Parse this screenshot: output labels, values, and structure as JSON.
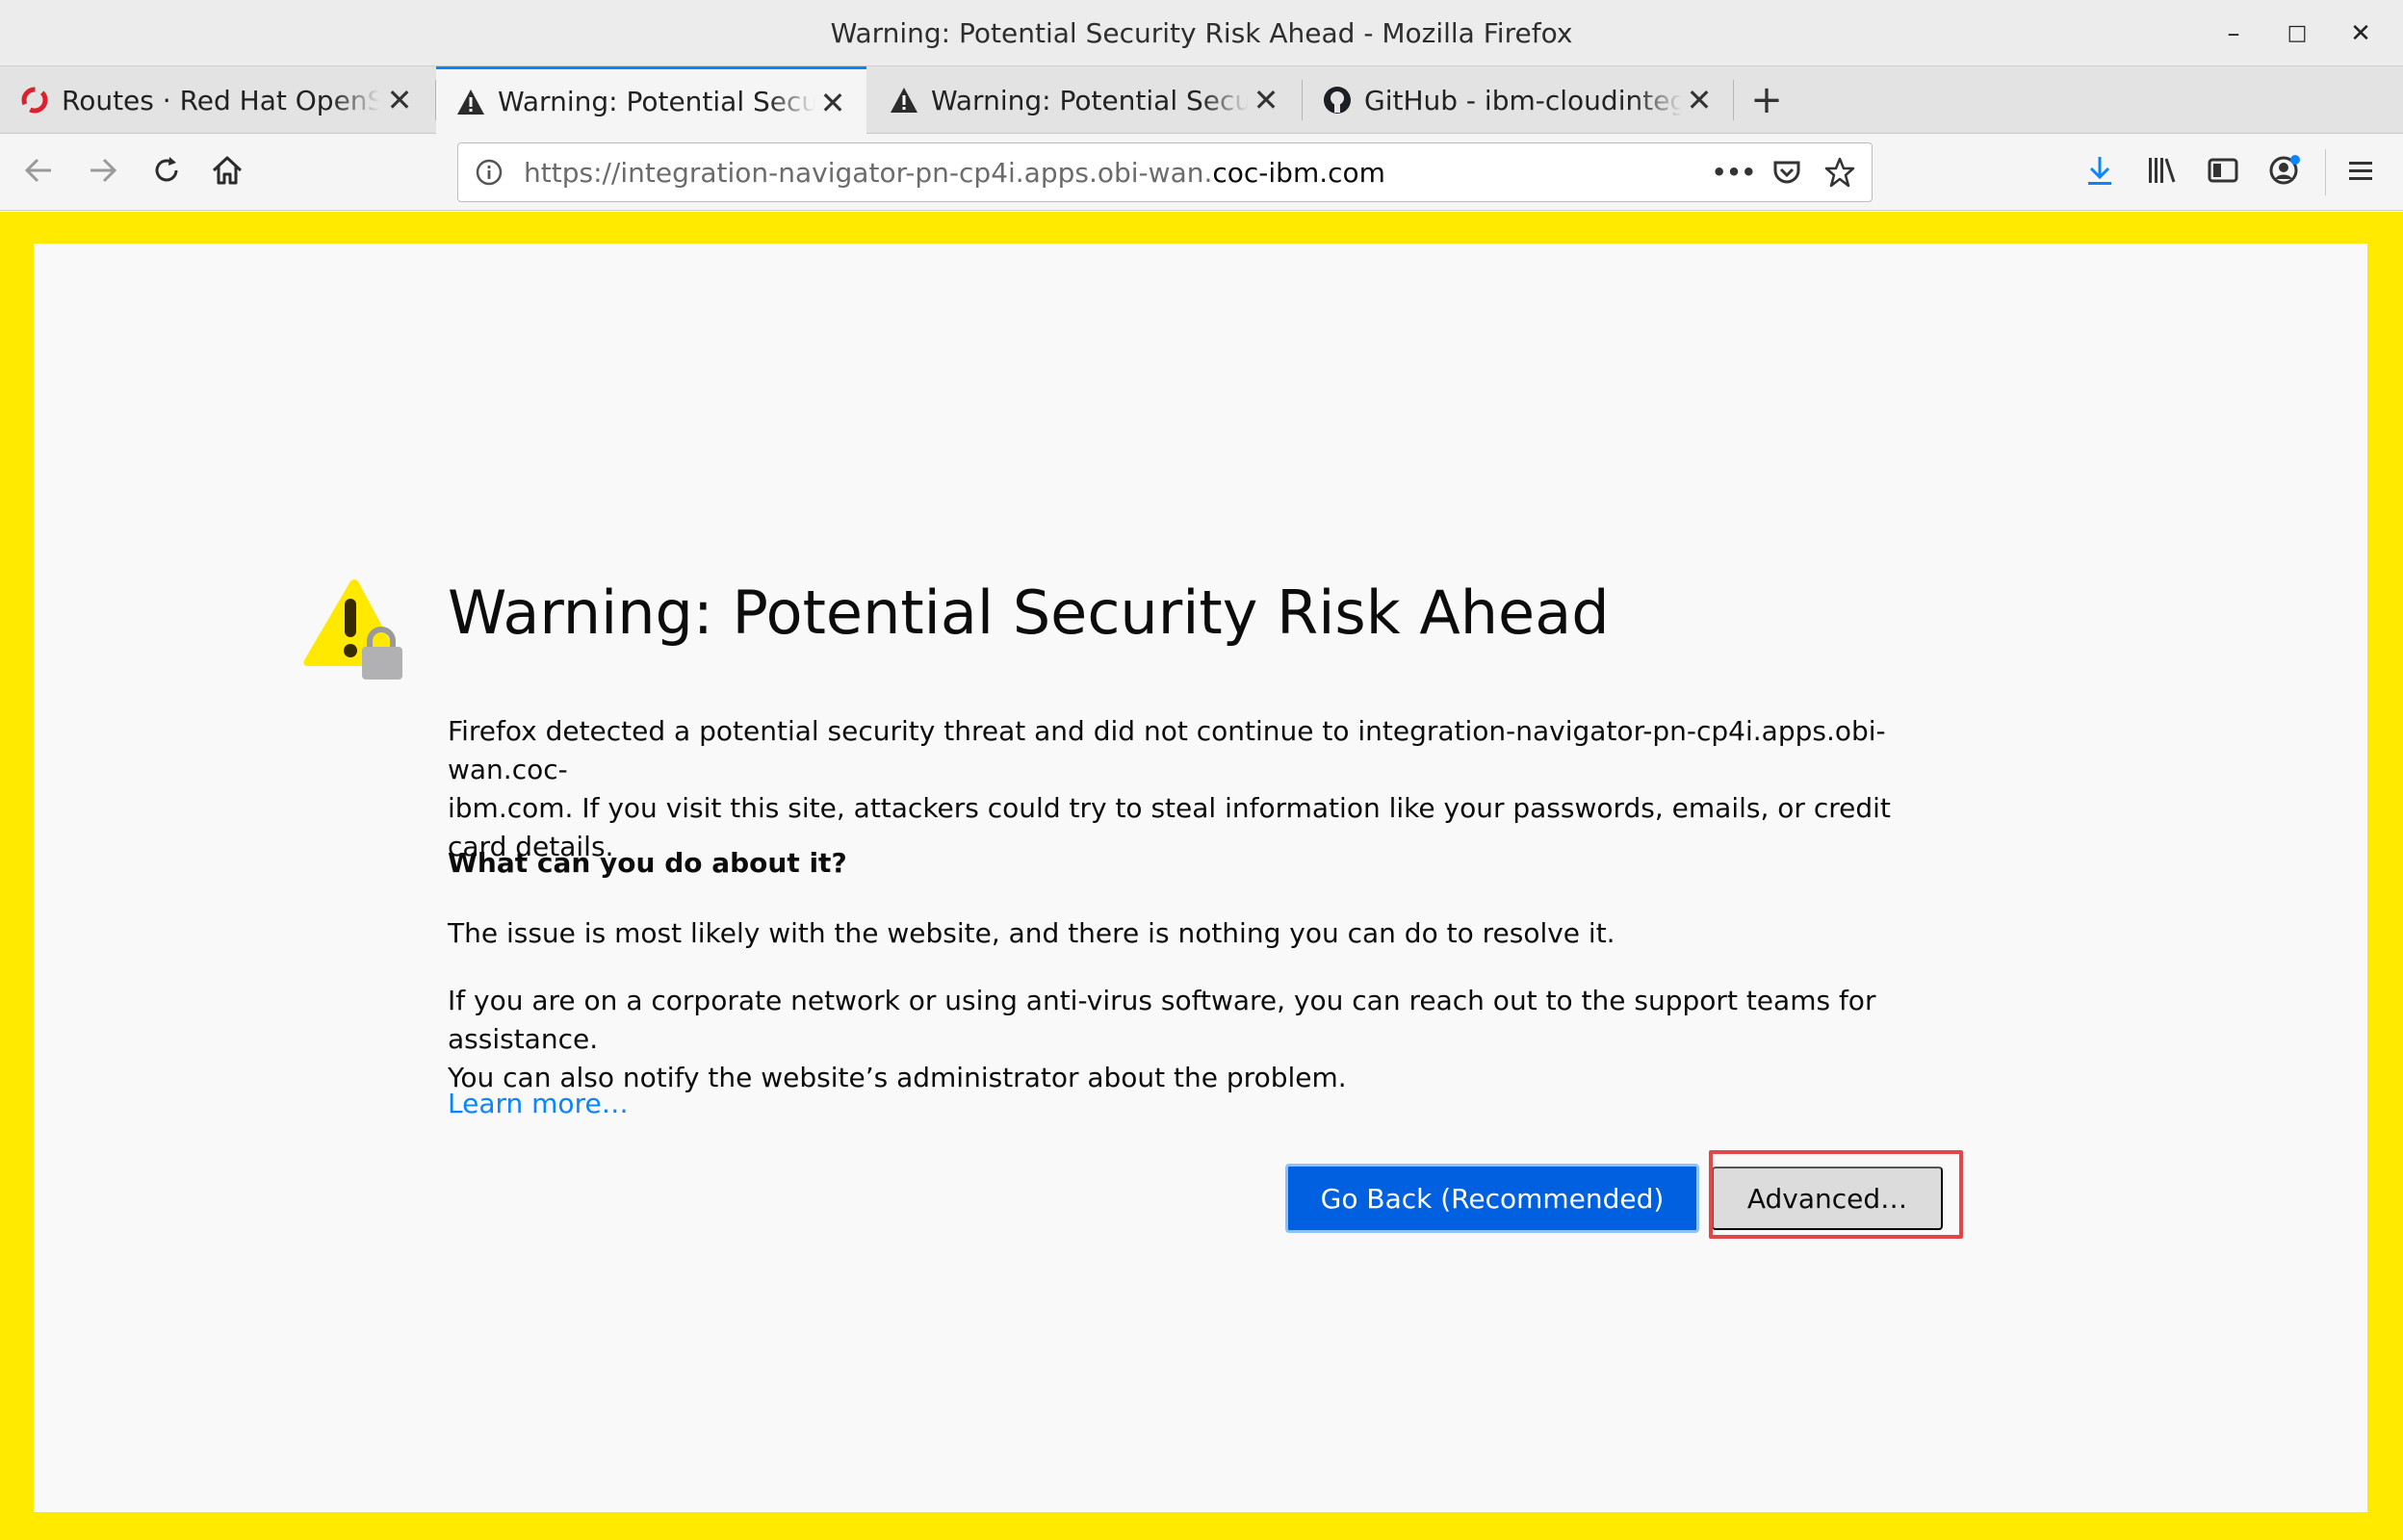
{
  "window": {
    "title": "Warning: Potential Security Risk Ahead - Mozilla Firefox",
    "controls": {
      "minimize": "–",
      "maximize": "□",
      "close": "✕"
    }
  },
  "tabs": [
    {
      "label": "Routes · Red Hat OpenShift",
      "icon": "openshift-icon",
      "active": false
    },
    {
      "label": "Warning: Potential Security Risk Ahead",
      "icon": "warning-icon",
      "active": true
    },
    {
      "label": "Warning: Potential Security Risk Ahead",
      "icon": "warning-icon",
      "active": false
    },
    {
      "label": "GitHub - ibm-cloudintegration",
      "icon": "github-icon",
      "active": false
    }
  ],
  "tab_close_glyph": "✕",
  "new_tab_glyph": "+",
  "navbar": {
    "url_prefix": "https://integration-navigator-pn-cp4i.apps.obi-wan.",
    "url_domain": "coc-ibm.com",
    "more_glyph": "•••"
  },
  "page": {
    "heading": "Warning: Potential Security Risk Ahead",
    "intro_line1": "Firefox detected a potential security threat and did not continue to integration-navigator-pn-cp4i.apps.obi-wan.coc-",
    "intro_line2": "ibm.com. If you visit this site, attackers could try to steal information like your passwords, emails, or credit card details.",
    "subheading": "What can you do about it?",
    "issue_text": "The issue is most likely with the website, and there is nothing you can do to resolve it.",
    "corporate_line1": "If you are on a corporate network or using anti-virus software, you can reach out to the support teams for assistance.",
    "corporate_line2": "You can also notify the website’s administrator about the problem.",
    "learn_more": "Learn more…",
    "go_back_button": "Go Back (Recommended)",
    "advanced_button": "Advanced…"
  },
  "colors": {
    "accent": "#0060df",
    "link": "#0a84ff",
    "frame_highlight": "#ffea00",
    "annotation_box": "#e04848"
  }
}
